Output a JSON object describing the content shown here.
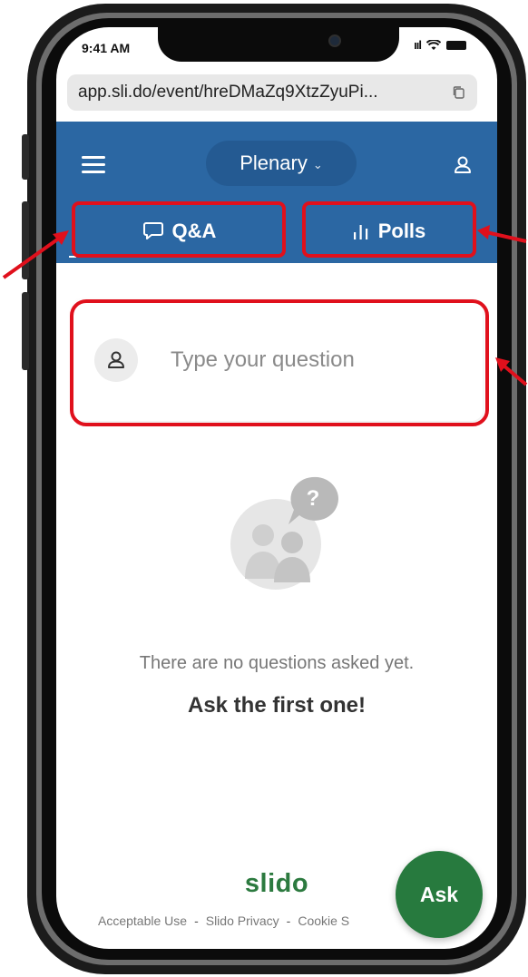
{
  "status_bar": {
    "time": "9:41 AM",
    "signal": "ııl"
  },
  "browser": {
    "url": "app.sli.do/event/hreDMaZq9XtzZyuPi..."
  },
  "header": {
    "event_name": "Plenary",
    "tabs": [
      {
        "label": "Q&A",
        "icon": "chat-bubbles-icon"
      },
      {
        "label": "Polls",
        "icon": "bar-chart-icon"
      }
    ]
  },
  "question": {
    "placeholder": "Type your question"
  },
  "empty_state": {
    "message": "There are no questions asked yet.",
    "cta": "Ask the first one!",
    "bubble_mark": "?"
  },
  "footer": {
    "logo": "slido",
    "links": [
      "Acceptable Use",
      "Slido Privacy",
      "Cookie S"
    ],
    "separator": "-"
  },
  "ask_button": {
    "label": "Ask"
  },
  "colors": {
    "header_bg": "#2b67a3",
    "ask_green": "#277a3e",
    "annotation_red": "#e0101c"
  }
}
